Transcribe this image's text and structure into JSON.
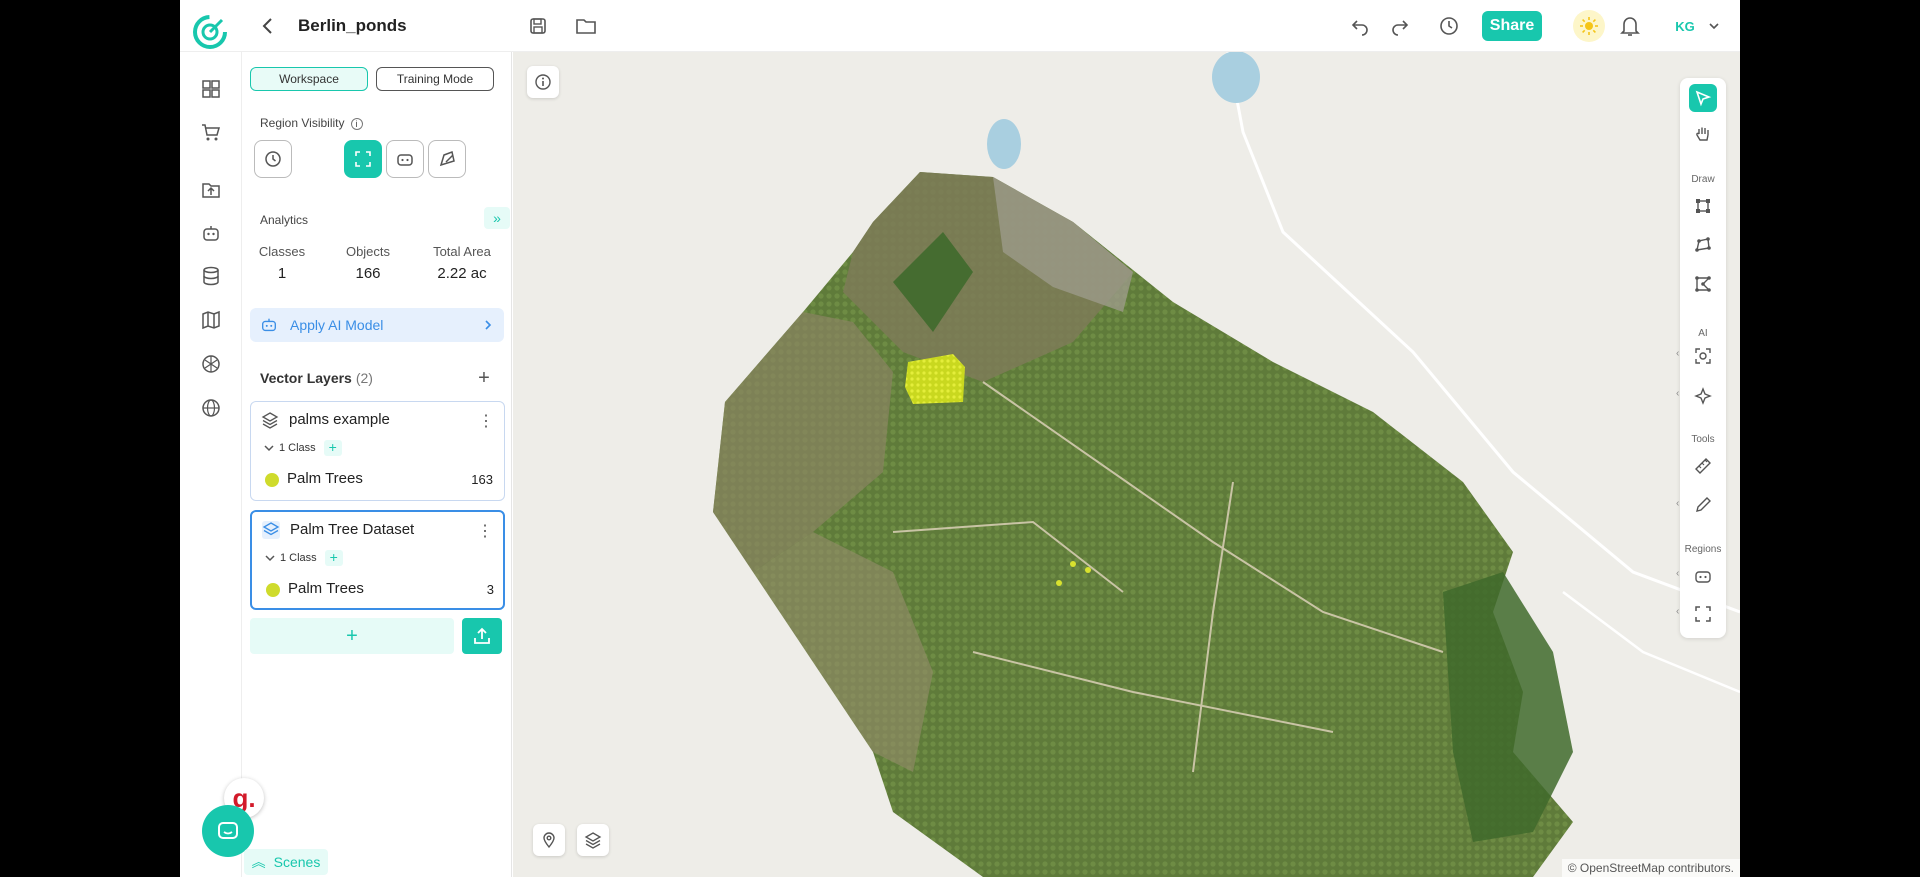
{
  "header": {
    "project_title": "Berlin_ponds",
    "share_label": "Share",
    "user_initials": "KG"
  },
  "panel": {
    "workspace_label": "Workspace",
    "training_label": "Training Mode",
    "region_visibility_label": "Region Visibility",
    "analytics_label": "Analytics",
    "stats": [
      {
        "label": "Classes",
        "value": "1"
      },
      {
        "label": "Objects",
        "value": "166"
      },
      {
        "label": "Total Area",
        "value": "2.22 ac"
      }
    ],
    "apply_ai_label": "Apply AI Model",
    "vector_layers_label": "Vector Layers",
    "vector_layers_count": "(2)",
    "layers": [
      {
        "name": "palms example",
        "class_count": "1 Class",
        "item_name": "Palm Trees",
        "item_count": "163",
        "item_color": "#cfdb2c"
      },
      {
        "name": "Palm Tree Dataset",
        "class_count": "1 Class",
        "item_name": "Palm Trees",
        "item_count": "3",
        "item_color": "#cfdb2c"
      }
    ],
    "scenes_label": "Scenes",
    "g_badge": "g."
  },
  "map": {
    "attribution": "© OpenStreetMap contributors."
  },
  "toolbar": {
    "draw_label": "Draw",
    "ai_label": "AI",
    "tools_label": "Tools",
    "regions_label": "Regions"
  },
  "colors": {
    "accent": "#18c7ad",
    "ai_blue": "#3a8ee6",
    "annotation": "#cfdb2c"
  }
}
